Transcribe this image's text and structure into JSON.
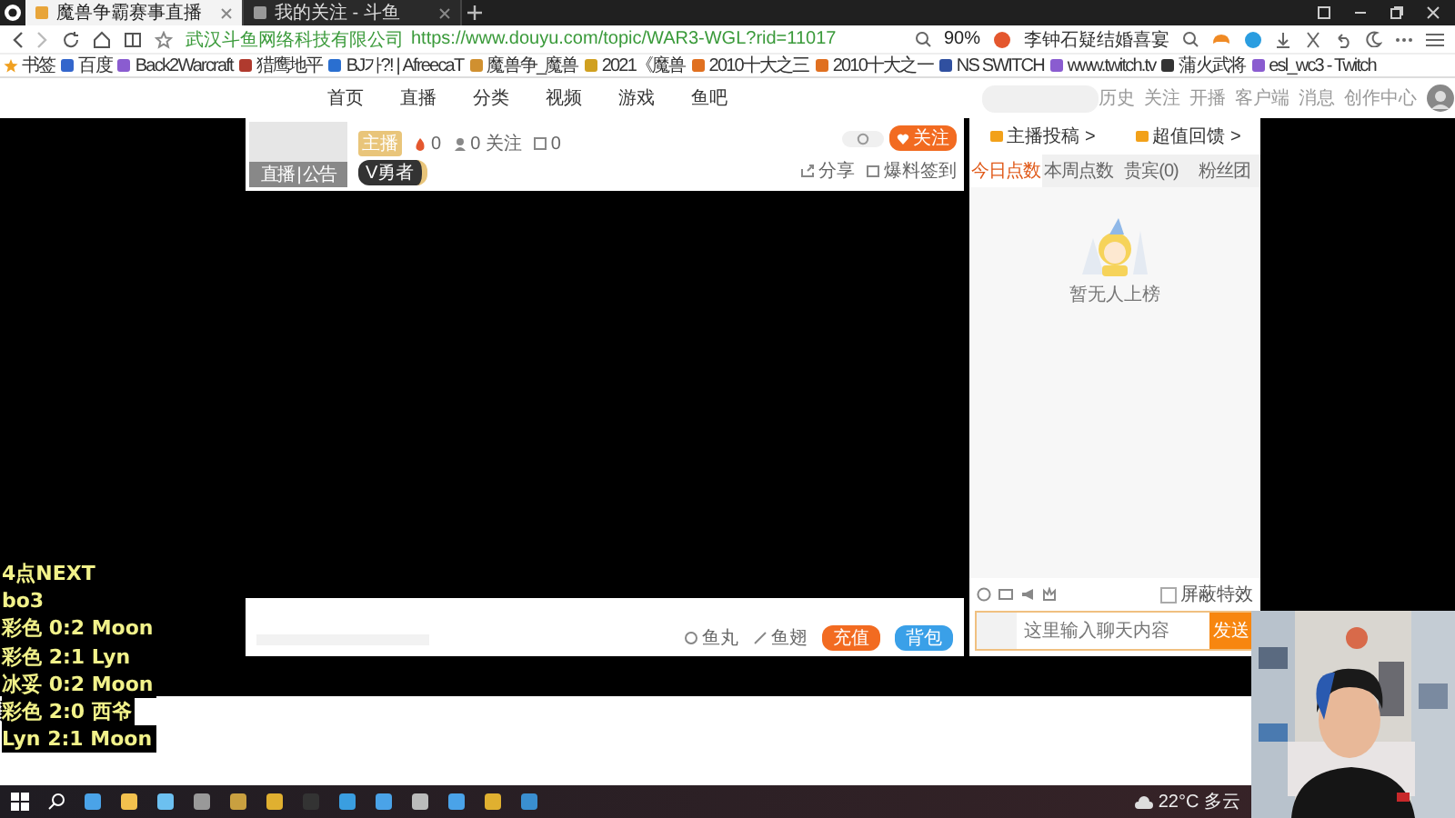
{
  "browser": {
    "tabs": [
      {
        "title": "魔兽争霸赛事直播",
        "selected": true
      },
      {
        "title": "我的关注 - 斗鱼",
        "selected": false
      }
    ],
    "site_identity": "武汉斗鱼网络科技有限公司",
    "url": "https://www.douyu.com/topic/WAR3-WGL?rid=11017",
    "zoom": "90%",
    "hot_search": "李钟石疑结婚喜宴",
    "bookmarks": [
      "书签",
      "百度",
      "Back2Warcraft",
      "猎鹰地平",
      "BJ가?! | AfreecaT",
      "魔兽争_魔兽",
      "2021《魔兽",
      "2010十大之三",
      "2010十大之一",
      "NS SWITCH",
      "www.twitch.tv",
      "蒲火武将",
      "esl_wc3 - Twitch"
    ]
  },
  "site": {
    "nav": [
      "首页",
      "直播",
      "分类",
      "视频",
      "游戏",
      "鱼吧"
    ],
    "user_links": [
      "历史",
      "关注",
      "开播",
      "客户端",
      "消息",
      "创作中心"
    ]
  },
  "player": {
    "thumb_label": "直播 | 公告",
    "tag": "主播",
    "stats": [
      "0",
      "0 关注",
      "0"
    ],
    "level": "V勇者",
    "follow": "关注",
    "share": "分享",
    "report": "爆料签到",
    "bottom": {
      "fish_ball": "鱼丸",
      "fish_fin": "鱼翅",
      "recharge": "充值",
      "bag": "背包"
    }
  },
  "chat": {
    "links": [
      "主播投稿 >",
      "超值回馈 >"
    ],
    "tabs": [
      {
        "label": "今日点数",
        "selected": true
      },
      {
        "label": "本周点数",
        "selected": false
      },
      {
        "label": "贵宾(0)",
        "selected": false
      },
      {
        "label": "粉丝团",
        "selected": false
      }
    ],
    "empty_text": "暂无人上榜",
    "block_effects": {
      "label": "屏蔽特效",
      "checked": false
    },
    "placeholder": "这里输入聊天内容",
    "send": "发送"
  },
  "overlay_lines": [
    "4点NEXT",
    "bo3",
    "彩色 0:2 Moon",
    "彩色 2:1 Lyn",
    "冰妥 0:2 Moon",
    "彩色 2:0 西爷",
    "Lyn 2:1 Moon"
  ],
  "taskbar": {
    "weather": "22°C 多云"
  }
}
